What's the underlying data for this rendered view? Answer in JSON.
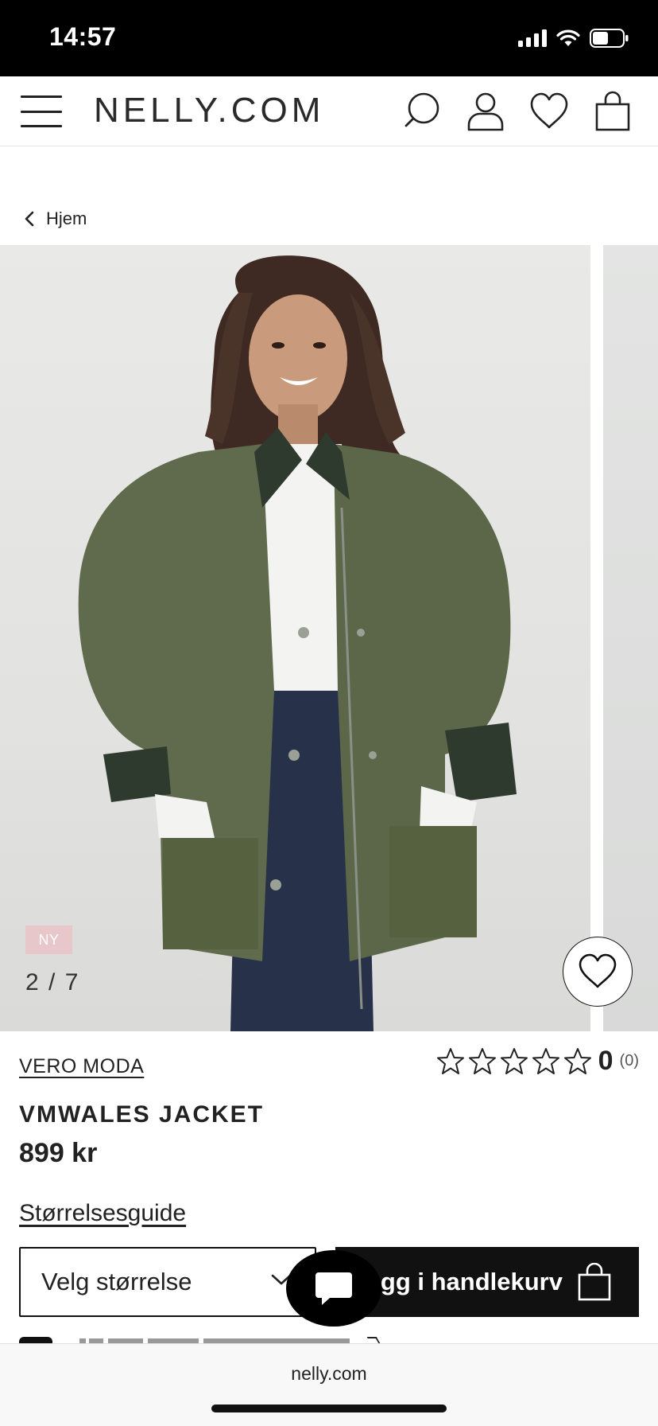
{
  "status_bar": {
    "time": "14:57"
  },
  "header": {
    "brand": "NELLY.COM"
  },
  "breadcrumb": {
    "label": "Hjem"
  },
  "gallery": {
    "badge": "NY",
    "counter": "2 / 7"
  },
  "product": {
    "brand": "VERO MODA",
    "name": "VMWALES JACKET",
    "price": "899 kr",
    "rating": {
      "value": "0",
      "count": "(0)",
      "stars_total": 5,
      "stars_filled": 0
    },
    "size_guide": "Størrelsesguide",
    "size_select": "Velg størrelse",
    "add_to_cart": "egg i handlekurv"
  },
  "browser": {
    "url": "nelly.com"
  },
  "colors": {
    "jacket": "#5f6b4c",
    "badge": "#e8c7ca",
    "button": "#111111"
  }
}
